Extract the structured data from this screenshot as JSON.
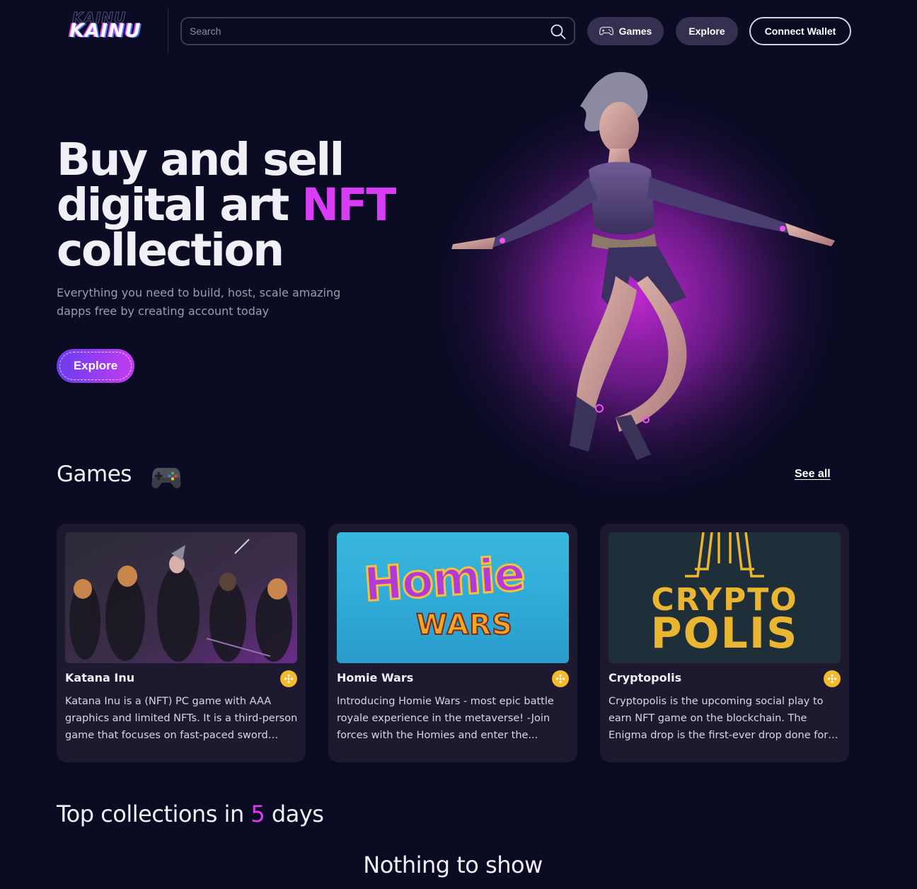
{
  "header": {
    "logo_text": "KAINU",
    "search_placeholder": "Search",
    "nav": {
      "games_label": "Games",
      "explore_label": "Explore",
      "connect_wallet_label": "Connect Wallet"
    }
  },
  "hero": {
    "title_line1": "Buy and sell",
    "title_line2_prefix": "digital art ",
    "title_line2_accent": "NFT",
    "title_line3": "collection",
    "subtitle": "Everything you need to build, host, scale amazing dapps free by creating account today",
    "explore_label": "Explore",
    "image_subject": "female-warrior-character"
  },
  "games_section": {
    "title": "Games",
    "title_icon": "gamepad-icon",
    "see_all_label": "See all",
    "cards": [
      {
        "name": "Katana Inu",
        "chain_icon": "bnb-chain-icon",
        "description": "Katana Inu is a (NFT) PC game with AAA graphics and limited NFTs. It is a third-person game that focuses on fast-paced sword and...",
        "image": "katana-inu-characters"
      },
      {
        "name": "Homie Wars",
        "chain_icon": "bnb-chain-icon",
        "description": "Introducing Homie Wars - most epic battle royale experience in the metaverse! -Join forces with the Homies and enter the...",
        "image": "homie-wars-logo",
        "image_text_1": "Homie",
        "image_text_2": "WARS"
      },
      {
        "name": "Cryptopolis",
        "chain_icon": "bnb-chain-icon",
        "description": "Cryptopolis is the upcoming social play to earn NFT game on the blockchain. The Enigma drop is the first-ever drop done for in...",
        "image": "cryptopolis-logo",
        "image_text_1": "CRYPTO",
        "image_text_2": "POLIS"
      }
    ]
  },
  "top_collections": {
    "title_prefix": "Top collections in ",
    "title_accent": "5",
    "title_suffix": " days",
    "empty_message": "Nothing to show"
  },
  "colors": {
    "background": "#0b0b24",
    "accent": "#d93cf5",
    "card_background": "#1d1a30",
    "pill_background": "#35304f",
    "bnb_yellow": "#f3ba2f"
  }
}
